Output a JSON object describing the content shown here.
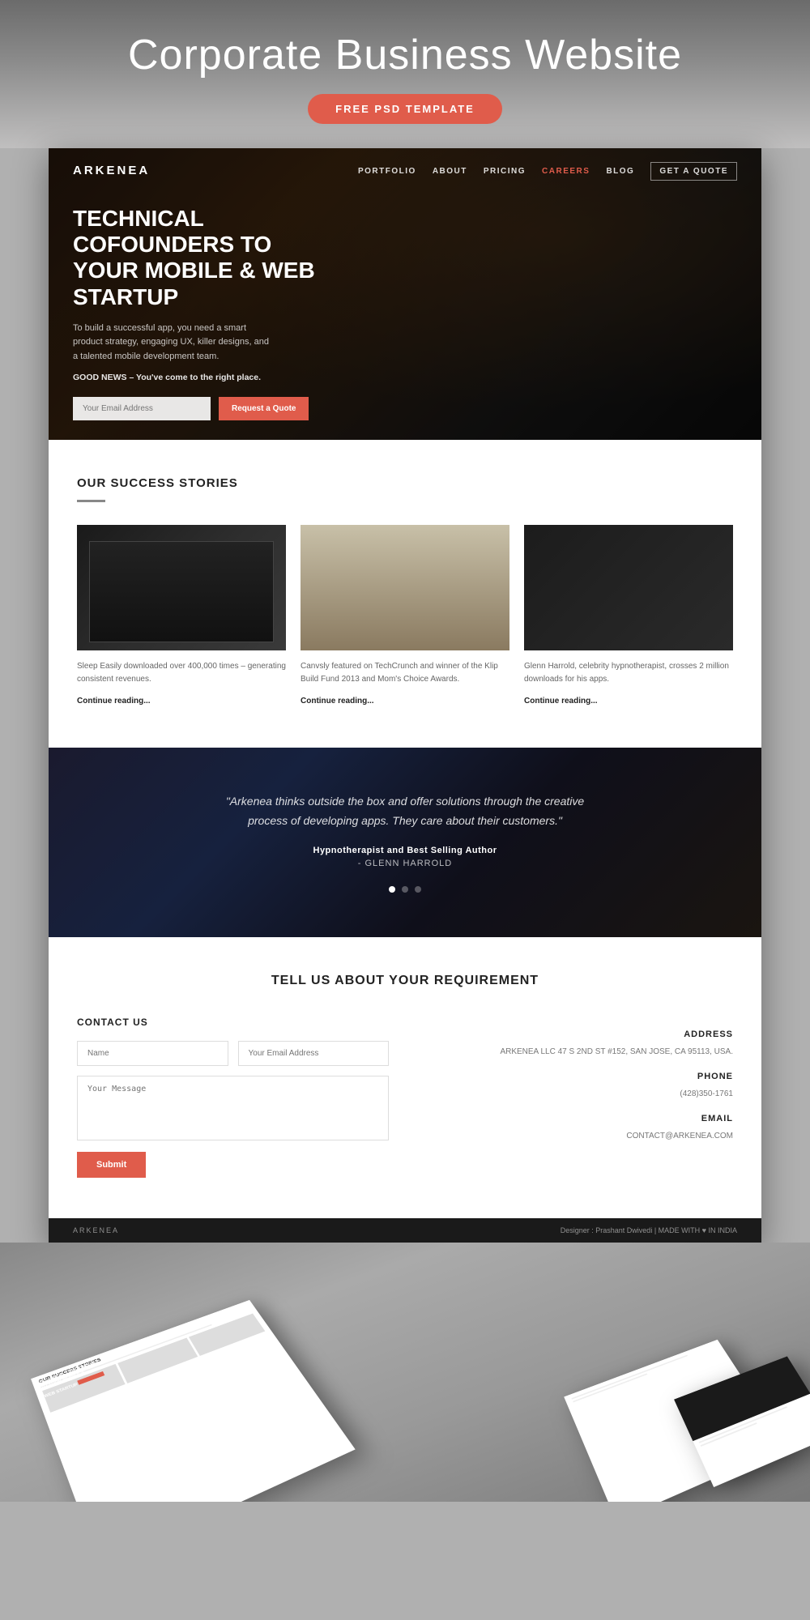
{
  "page": {
    "title": "Corporate Business Website",
    "free_psd_label": "FREE PSD TEMPLATE"
  },
  "nav": {
    "logo": "ARKENEA",
    "links": [
      {
        "label": "PORTFOLIO",
        "active": false
      },
      {
        "label": "ABOUT",
        "active": false
      },
      {
        "label": "PRICING",
        "active": false
      },
      {
        "label": "CAREERS",
        "active": true
      },
      {
        "label": "BLOG",
        "active": false
      },
      {
        "label": "GET A QUOTE",
        "active": false,
        "is_quote": true
      }
    ]
  },
  "hero": {
    "headline": "TECHNICAL COFOUNDERS TO YOUR MOBILE & WEB STARTUP",
    "subtext": "To build a successful app, you need a smart product strategy, engaging UX, killer designs, and a talented mobile development team.",
    "good_news_label": "GOOD NEWS",
    "good_news_text": " – You've come to the right place.",
    "email_placeholder": "Your Email Address",
    "quote_button": "Request a Quote"
  },
  "success_stories": {
    "section_title": "OUR SUCCESS STORIES",
    "stories": [
      {
        "desc": "Sleep Easily downloaded over 400,000 times – generating consistent revenues.",
        "link": "Continue reading..."
      },
      {
        "desc": "Canvsly featured on TechCrunch and winner of the Klip Build Fund 2013 and Mom's Choice Awards.",
        "link": "Continue reading..."
      },
      {
        "desc": "Glenn Harrold, celebrity hypnotherapist, crosses 2 million downloads for his apps.",
        "link": "Continue reading..."
      }
    ]
  },
  "testimonial": {
    "quote": "\"Arkenea thinks outside the box and offer solutions through the creative process of developing apps. They care about their customers.\"",
    "author_title": "Hypnotherapist and Best Selling Author",
    "author_name": "- GLENN HARROLD",
    "dots": [
      {
        "active": true
      },
      {
        "active": false
      },
      {
        "active": false
      }
    ]
  },
  "contact": {
    "section_title": "TELL US ABOUT YOUR REQUIREMENT",
    "contact_us_label": "CONTACT US",
    "name_placeholder": "Name",
    "email_placeholder": "Your Email Address",
    "message_placeholder": "Your Message",
    "submit_label": "Submit",
    "address_label": "ADDRESS",
    "address_text": "ARKENEA LLC 47 S 2ND ST #152, SAN JOSE, CA 95113, USA.",
    "phone_label": "PHONE",
    "phone_text": "(428)350-1761",
    "email_label": "EMAIL",
    "email_text": "CONTACT@ARKENEA.COM"
  },
  "footer": {
    "logo": "ARKENEA",
    "credit": "Designer : Prashant Dwivedi | MADE WITH ♥ IN INDIA"
  }
}
